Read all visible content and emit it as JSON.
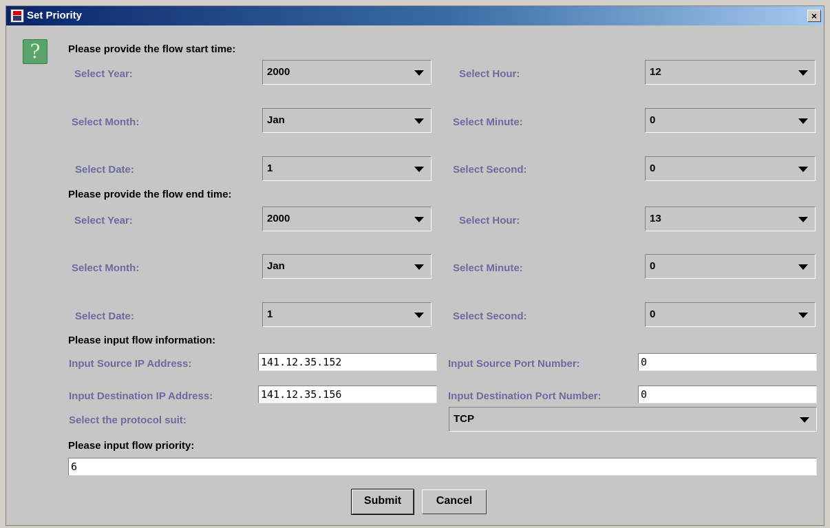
{
  "window": {
    "title": "Set Priority",
    "close_label": "×"
  },
  "icons": {
    "question": "?"
  },
  "start": {
    "heading": "Please provide the flow start time:",
    "year_label": "Select Year:",
    "year": "2000",
    "month_label": "Select Month:",
    "month": "Jan",
    "date_label": "Select Date:",
    "date": "1",
    "hour_label": "Select Hour:",
    "hour": "12",
    "minute_label": "Select Minute:",
    "minute": "0",
    "second_label": "Select Second:",
    "second": "0"
  },
  "end": {
    "heading": "Please provide the flow end time:",
    "year_label": "Select Year:",
    "year": "2000",
    "month_label": "Select Month:",
    "month": "Jan",
    "date_label": "Select Date:",
    "date": "1",
    "hour_label": "Select Hour:",
    "hour": "13",
    "minute_label": "Select Minute:",
    "minute": "0",
    "second_label": "Select Second:",
    "second": "0"
  },
  "flow": {
    "heading": "Please input flow information:",
    "src_ip_label": "Input Source IP Address:",
    "src_ip": "141.12.35.152",
    "dst_ip_label": "Input Destination IP Address:",
    "dst_ip": "141.12.35.156",
    "src_port_label": "Input Source Port Number:",
    "src_port": "0",
    "dst_port_label": "Input Destination Port Number:",
    "dst_port": "0",
    "protocol_label": "Select the protocol suit:",
    "protocol": "TCP"
  },
  "priority": {
    "heading": "Please input flow priority:",
    "value": "6"
  },
  "buttons": {
    "submit": "Submit",
    "cancel": "Cancel"
  }
}
